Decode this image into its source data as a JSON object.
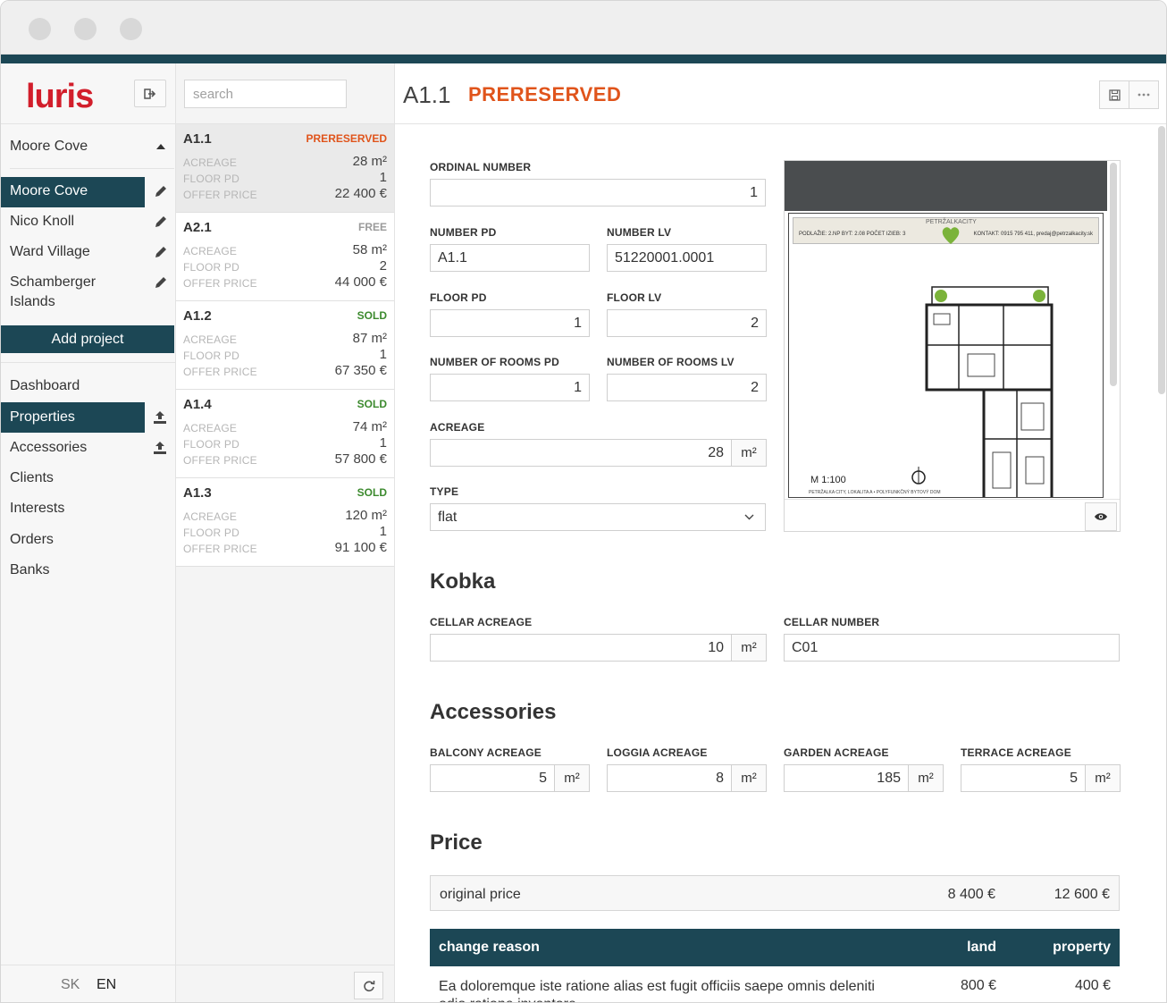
{
  "brand": {
    "logo_text": "luris",
    "accent": "#1c4755",
    "logo_color": "#d21e2b"
  },
  "sidebar": {
    "current_project": "Moore Cove",
    "projects": [
      {
        "label": "Moore Cove",
        "active": true
      },
      {
        "label": "Nico Knoll",
        "active": false
      },
      {
        "label": "Ward Village",
        "active": false
      },
      {
        "label": "Schamberger Islands",
        "active": false
      }
    ],
    "add_project_label": "Add project",
    "nav": [
      {
        "label": "Dashboard",
        "active": false,
        "upload": false
      },
      {
        "label": "Properties",
        "active": true,
        "upload": true
      },
      {
        "label": "Accessories",
        "active": false,
        "upload": true
      },
      {
        "label": "Clients",
        "active": false,
        "upload": false
      },
      {
        "label": "Interests",
        "active": false,
        "upload": false
      },
      {
        "label": "Orders",
        "active": false,
        "upload": false
      },
      {
        "label": "Banks",
        "active": false,
        "upload": false
      }
    ],
    "languages": [
      "SK",
      "EN"
    ]
  },
  "list": {
    "search_placeholder": "search",
    "field_labels": {
      "acreage": "ACREAGE",
      "floor": "FLOOR PD",
      "price": "OFFER PRICE"
    },
    "items": [
      {
        "code": "A1.1",
        "status": "PRERESERVED",
        "status_color": "#e0541b",
        "acreage": "28 m²",
        "floor": "1",
        "price": "22 400 €",
        "selected": true
      },
      {
        "code": "A2.1",
        "status": "FREE",
        "status_color": "#9a9a9a",
        "acreage": "58 m²",
        "floor": "2",
        "price": "44 000 €",
        "selected": false
      },
      {
        "code": "A1.2",
        "status": "SOLD",
        "status_color": "#3c8a2e",
        "acreage": "87 m²",
        "floor": "1",
        "price": "67 350 €",
        "selected": false
      },
      {
        "code": "A1.4",
        "status": "SOLD",
        "status_color": "#3c8a2e",
        "acreage": "74 m²",
        "floor": "1",
        "price": "57 800 €",
        "selected": false
      },
      {
        "code": "A1.3",
        "status": "SOLD",
        "status_color": "#3c8a2e",
        "acreage": "120 m²",
        "floor": "1",
        "price": "91 100 €",
        "selected": false
      }
    ]
  },
  "detail": {
    "title": "A1.1",
    "status": "PRERESERVED",
    "fields": {
      "ordinal_number": {
        "label": "ORDINAL NUMBER",
        "value": "1"
      },
      "number_pd": {
        "label": "NUMBER PD",
        "value": "A1.1"
      },
      "number_lv": {
        "label": "NUMBER LV",
        "value": "51220001.0001"
      },
      "floor_pd": {
        "label": "FLOOR PD",
        "value": "1"
      },
      "floor_lv": {
        "label": "FLOOR LV",
        "value": "2"
      },
      "rooms_pd": {
        "label": "NUMBER OF ROOMS PD",
        "value": "1"
      },
      "rooms_lv": {
        "label": "NUMBER OF ROOMS LV",
        "value": "2"
      },
      "acreage": {
        "label": "ACREAGE",
        "value": "28",
        "unit": "m²"
      },
      "type": {
        "label": "TYPE",
        "value": "flat"
      }
    },
    "floorplan": {
      "brand": "PETRŽALKACITY",
      "info_left": "PODLAŽIE: 2.NP   BYT: 2.08   POČET IZIEB: 3",
      "info_right": "KONTAKT: 0915 795 411, predaj@petrzalkacity.sk",
      "scale": "M 1:100",
      "footer": "PETRŽALKA CITY, LOKALITA A • POLYFUNKČNÝ BYTOVÝ DOM"
    },
    "kobka": {
      "title": "Kobka",
      "cellar_acreage": {
        "label": "CELLAR ACREAGE",
        "value": "10",
        "unit": "m²"
      },
      "cellar_number": {
        "label": "CELLAR NUMBER",
        "value": "C01"
      }
    },
    "accessories": {
      "title": "Accessories",
      "items": [
        {
          "label": "BALCONY ACREAGE",
          "value": "5",
          "unit": "m²"
        },
        {
          "label": "LOGGIA ACREAGE",
          "value": "8",
          "unit": "m²"
        },
        {
          "label": "GARDEN ACREAGE",
          "value": "185",
          "unit": "m²"
        },
        {
          "label": "TERRACE ACREAGE",
          "value": "5",
          "unit": "m²"
        }
      ]
    },
    "price": {
      "title": "Price",
      "original": {
        "label": "original price",
        "land": "8 400 €",
        "property": "12 600 €"
      },
      "table_headers": {
        "reason": "change reason",
        "land": "land",
        "property": "property"
      },
      "rows": [
        {
          "reason": "Ea doloremque iste ratione alias est fugit officiis saepe omnis deleniti odio ratione inventore.",
          "land": "800 €",
          "property": "400 €"
        }
      ]
    }
  }
}
